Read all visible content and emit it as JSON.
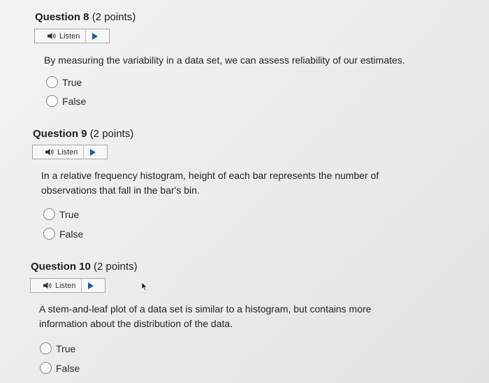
{
  "questions": [
    {
      "name": "Question 8",
      "points": "(2 points)",
      "listen_label": "Listen",
      "text": "By measuring the variability in a data set, we can assess reliability of our estimates.",
      "options": [
        "True",
        "False"
      ]
    },
    {
      "name": "Question 9",
      "points": "(2 points)",
      "listen_label": "Listen",
      "text": "In a relative frequency histogram, height of each bar represents the number of observations that fall in the bar's bin.",
      "options": [
        "True",
        "False"
      ]
    },
    {
      "name": "Question 10",
      "points": "(2 points)",
      "listen_label": "Listen",
      "text": "A stem-and-leaf plot of a data set is similar to a histogram, but contains more information about the distribution of the data.",
      "options": [
        "True",
        "False"
      ]
    }
  ],
  "colors": {
    "play_icon": "#1f5f9c",
    "text": "#242424"
  },
  "icons": {
    "listen": "speaker-icon",
    "play": "play-icon",
    "cursor": "mouse-pointer-icon"
  }
}
